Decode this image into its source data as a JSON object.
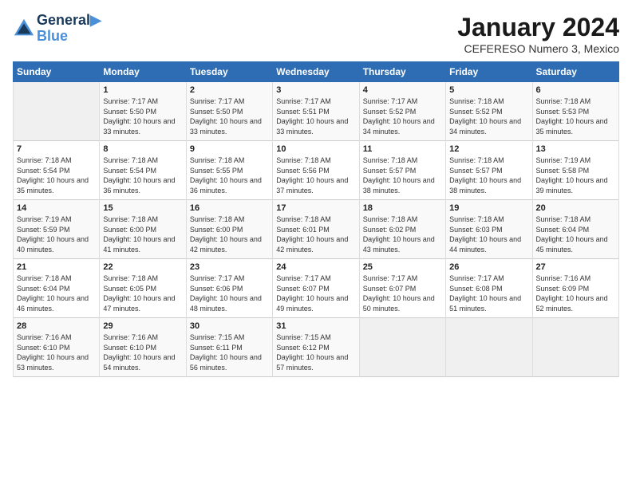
{
  "header": {
    "logo_line1": "General",
    "logo_line2": "Blue",
    "month_title": "January 2024",
    "subtitle": "CEFERESO Numero 3, Mexico"
  },
  "days_of_week": [
    "Sunday",
    "Monday",
    "Tuesday",
    "Wednesday",
    "Thursday",
    "Friday",
    "Saturday"
  ],
  "weeks": [
    [
      {
        "day": "",
        "sunrise": "",
        "sunset": "",
        "daylight": ""
      },
      {
        "day": "1",
        "sunrise": "Sunrise: 7:17 AM",
        "sunset": "Sunset: 5:50 PM",
        "daylight": "Daylight: 10 hours and 33 minutes."
      },
      {
        "day": "2",
        "sunrise": "Sunrise: 7:17 AM",
        "sunset": "Sunset: 5:50 PM",
        "daylight": "Daylight: 10 hours and 33 minutes."
      },
      {
        "day": "3",
        "sunrise": "Sunrise: 7:17 AM",
        "sunset": "Sunset: 5:51 PM",
        "daylight": "Daylight: 10 hours and 33 minutes."
      },
      {
        "day": "4",
        "sunrise": "Sunrise: 7:17 AM",
        "sunset": "Sunset: 5:52 PM",
        "daylight": "Daylight: 10 hours and 34 minutes."
      },
      {
        "day": "5",
        "sunrise": "Sunrise: 7:18 AM",
        "sunset": "Sunset: 5:52 PM",
        "daylight": "Daylight: 10 hours and 34 minutes."
      },
      {
        "day": "6",
        "sunrise": "Sunrise: 7:18 AM",
        "sunset": "Sunset: 5:53 PM",
        "daylight": "Daylight: 10 hours and 35 minutes."
      }
    ],
    [
      {
        "day": "7",
        "sunrise": "Sunrise: 7:18 AM",
        "sunset": "Sunset: 5:54 PM",
        "daylight": "Daylight: 10 hours and 35 minutes."
      },
      {
        "day": "8",
        "sunrise": "Sunrise: 7:18 AM",
        "sunset": "Sunset: 5:54 PM",
        "daylight": "Daylight: 10 hours and 36 minutes."
      },
      {
        "day": "9",
        "sunrise": "Sunrise: 7:18 AM",
        "sunset": "Sunset: 5:55 PM",
        "daylight": "Daylight: 10 hours and 36 minutes."
      },
      {
        "day": "10",
        "sunrise": "Sunrise: 7:18 AM",
        "sunset": "Sunset: 5:56 PM",
        "daylight": "Daylight: 10 hours and 37 minutes."
      },
      {
        "day": "11",
        "sunrise": "Sunrise: 7:18 AM",
        "sunset": "Sunset: 5:57 PM",
        "daylight": "Daylight: 10 hours and 38 minutes."
      },
      {
        "day": "12",
        "sunrise": "Sunrise: 7:18 AM",
        "sunset": "Sunset: 5:57 PM",
        "daylight": "Daylight: 10 hours and 38 minutes."
      },
      {
        "day": "13",
        "sunrise": "Sunrise: 7:19 AM",
        "sunset": "Sunset: 5:58 PM",
        "daylight": "Daylight: 10 hours and 39 minutes."
      }
    ],
    [
      {
        "day": "14",
        "sunrise": "Sunrise: 7:19 AM",
        "sunset": "Sunset: 5:59 PM",
        "daylight": "Daylight: 10 hours and 40 minutes."
      },
      {
        "day": "15",
        "sunrise": "Sunrise: 7:18 AM",
        "sunset": "Sunset: 6:00 PM",
        "daylight": "Daylight: 10 hours and 41 minutes."
      },
      {
        "day": "16",
        "sunrise": "Sunrise: 7:18 AM",
        "sunset": "Sunset: 6:00 PM",
        "daylight": "Daylight: 10 hours and 42 minutes."
      },
      {
        "day": "17",
        "sunrise": "Sunrise: 7:18 AM",
        "sunset": "Sunset: 6:01 PM",
        "daylight": "Daylight: 10 hours and 42 minutes."
      },
      {
        "day": "18",
        "sunrise": "Sunrise: 7:18 AM",
        "sunset": "Sunset: 6:02 PM",
        "daylight": "Daylight: 10 hours and 43 minutes."
      },
      {
        "day": "19",
        "sunrise": "Sunrise: 7:18 AM",
        "sunset": "Sunset: 6:03 PM",
        "daylight": "Daylight: 10 hours and 44 minutes."
      },
      {
        "day": "20",
        "sunrise": "Sunrise: 7:18 AM",
        "sunset": "Sunset: 6:04 PM",
        "daylight": "Daylight: 10 hours and 45 minutes."
      }
    ],
    [
      {
        "day": "21",
        "sunrise": "Sunrise: 7:18 AM",
        "sunset": "Sunset: 6:04 PM",
        "daylight": "Daylight: 10 hours and 46 minutes."
      },
      {
        "day": "22",
        "sunrise": "Sunrise: 7:18 AM",
        "sunset": "Sunset: 6:05 PM",
        "daylight": "Daylight: 10 hours and 47 minutes."
      },
      {
        "day": "23",
        "sunrise": "Sunrise: 7:17 AM",
        "sunset": "Sunset: 6:06 PM",
        "daylight": "Daylight: 10 hours and 48 minutes."
      },
      {
        "day": "24",
        "sunrise": "Sunrise: 7:17 AM",
        "sunset": "Sunset: 6:07 PM",
        "daylight": "Daylight: 10 hours and 49 minutes."
      },
      {
        "day": "25",
        "sunrise": "Sunrise: 7:17 AM",
        "sunset": "Sunset: 6:07 PM",
        "daylight": "Daylight: 10 hours and 50 minutes."
      },
      {
        "day": "26",
        "sunrise": "Sunrise: 7:17 AM",
        "sunset": "Sunset: 6:08 PM",
        "daylight": "Daylight: 10 hours and 51 minutes."
      },
      {
        "day": "27",
        "sunrise": "Sunrise: 7:16 AM",
        "sunset": "Sunset: 6:09 PM",
        "daylight": "Daylight: 10 hours and 52 minutes."
      }
    ],
    [
      {
        "day": "28",
        "sunrise": "Sunrise: 7:16 AM",
        "sunset": "Sunset: 6:10 PM",
        "daylight": "Daylight: 10 hours and 53 minutes."
      },
      {
        "day": "29",
        "sunrise": "Sunrise: 7:16 AM",
        "sunset": "Sunset: 6:10 PM",
        "daylight": "Daylight: 10 hours and 54 minutes."
      },
      {
        "day": "30",
        "sunrise": "Sunrise: 7:15 AM",
        "sunset": "Sunset: 6:11 PM",
        "daylight": "Daylight: 10 hours and 56 minutes."
      },
      {
        "day": "31",
        "sunrise": "Sunrise: 7:15 AM",
        "sunset": "Sunset: 6:12 PM",
        "daylight": "Daylight: 10 hours and 57 minutes."
      },
      {
        "day": "",
        "sunrise": "",
        "sunset": "",
        "daylight": ""
      },
      {
        "day": "",
        "sunrise": "",
        "sunset": "",
        "daylight": ""
      },
      {
        "day": "",
        "sunrise": "",
        "sunset": "",
        "daylight": ""
      }
    ]
  ]
}
